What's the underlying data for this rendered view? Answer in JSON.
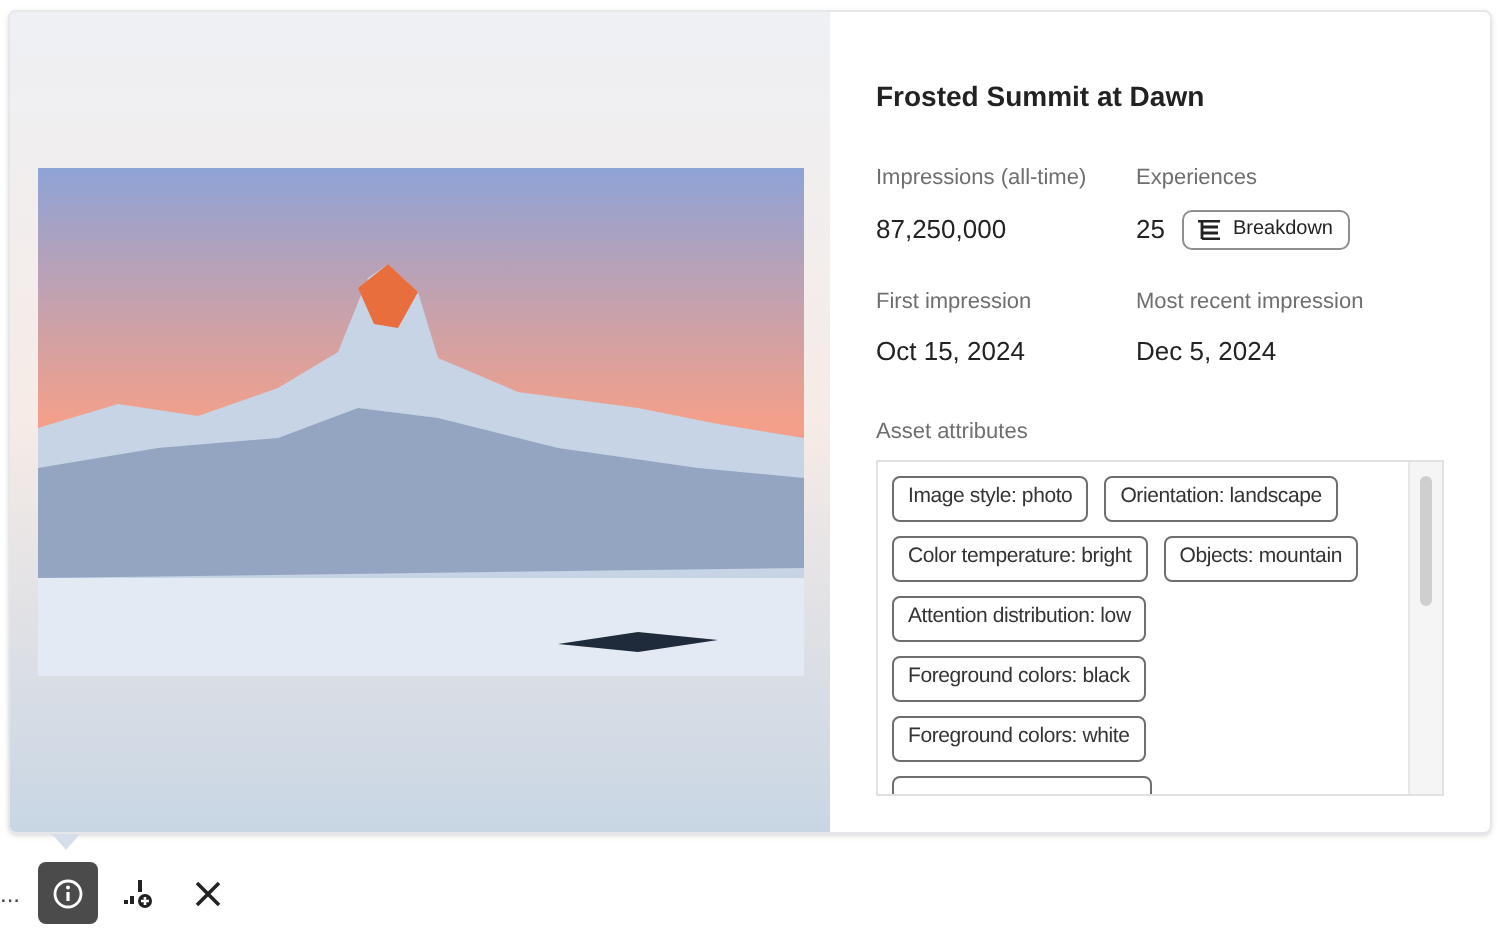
{
  "asset": {
    "title": "Frosted Summit at Dawn",
    "stats": [
      {
        "label": "Impressions (all-time)",
        "value": "87,250,000"
      },
      {
        "label": "Experiences",
        "value": "25",
        "button": "Breakdown"
      },
      {
        "label": "First impression",
        "value": "Oct 15, 2024"
      },
      {
        "label": "Most recent impression",
        "value": "Dec 5, 2024"
      }
    ],
    "attributes_label": "Asset attributes",
    "attributes": [
      "Image style: photo",
      "Orientation: landscape",
      "Color temperature: bright",
      "Objects: mountain",
      "Attention distribution: low",
      "Foreground colors: black",
      "Foreground colors: white"
    ]
  },
  "toolbar": {
    "overflow": "...",
    "buttons": [
      {
        "kind": "info",
        "selected": true
      },
      {
        "kind": "chart-add",
        "selected": false
      },
      {
        "kind": "close",
        "selected": false
      }
    ]
  }
}
